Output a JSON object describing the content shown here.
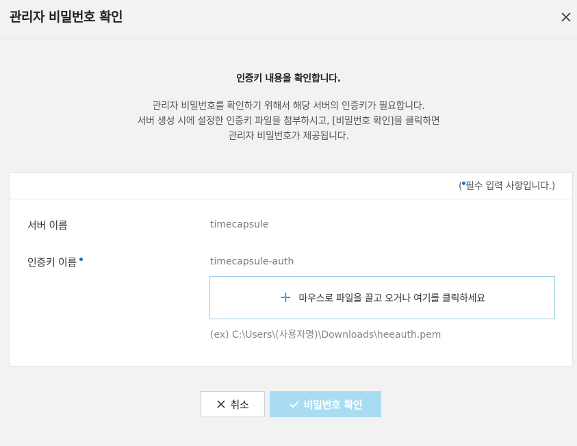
{
  "dialog": {
    "title": "관리자 비밀번호 확인",
    "close_icon": "close-icon"
  },
  "intro": {
    "heading": "인증키 내용을 확인합니다.",
    "lines": [
      "관리자 비밀번호를 확인하기 위해서 해당 서버의 인증키가 필요합니다.",
      "서버 생성 시에 설정한 인증키 파일을 첨부하시고, [비밀번호 확인]을 클릭하면",
      "관리자 비밀번호가 제공됩니다."
    ]
  },
  "form": {
    "required_prefix": "(",
    "required_note": "필수 입력 사항입니다.)",
    "server_name_label": "서버 이름",
    "server_name_value": "timecapsule",
    "auth_key_label": "인증키 이름",
    "auth_key_value": "timecapsule-auth",
    "dropzone_text": "마우스로 파일을 끌고 오거나 여기를 클릭하세요",
    "example_path": "(ex) C:\\Users\\(사용자명)\\Downloads\\heeauth.pem"
  },
  "buttons": {
    "cancel_label": "취소",
    "confirm_label": "비밀번호 확인"
  },
  "colors": {
    "accent": "#1a6fcf",
    "dropzone_border": "#9ccbe8",
    "confirm_disabled_bg": "#a9dcf3"
  }
}
